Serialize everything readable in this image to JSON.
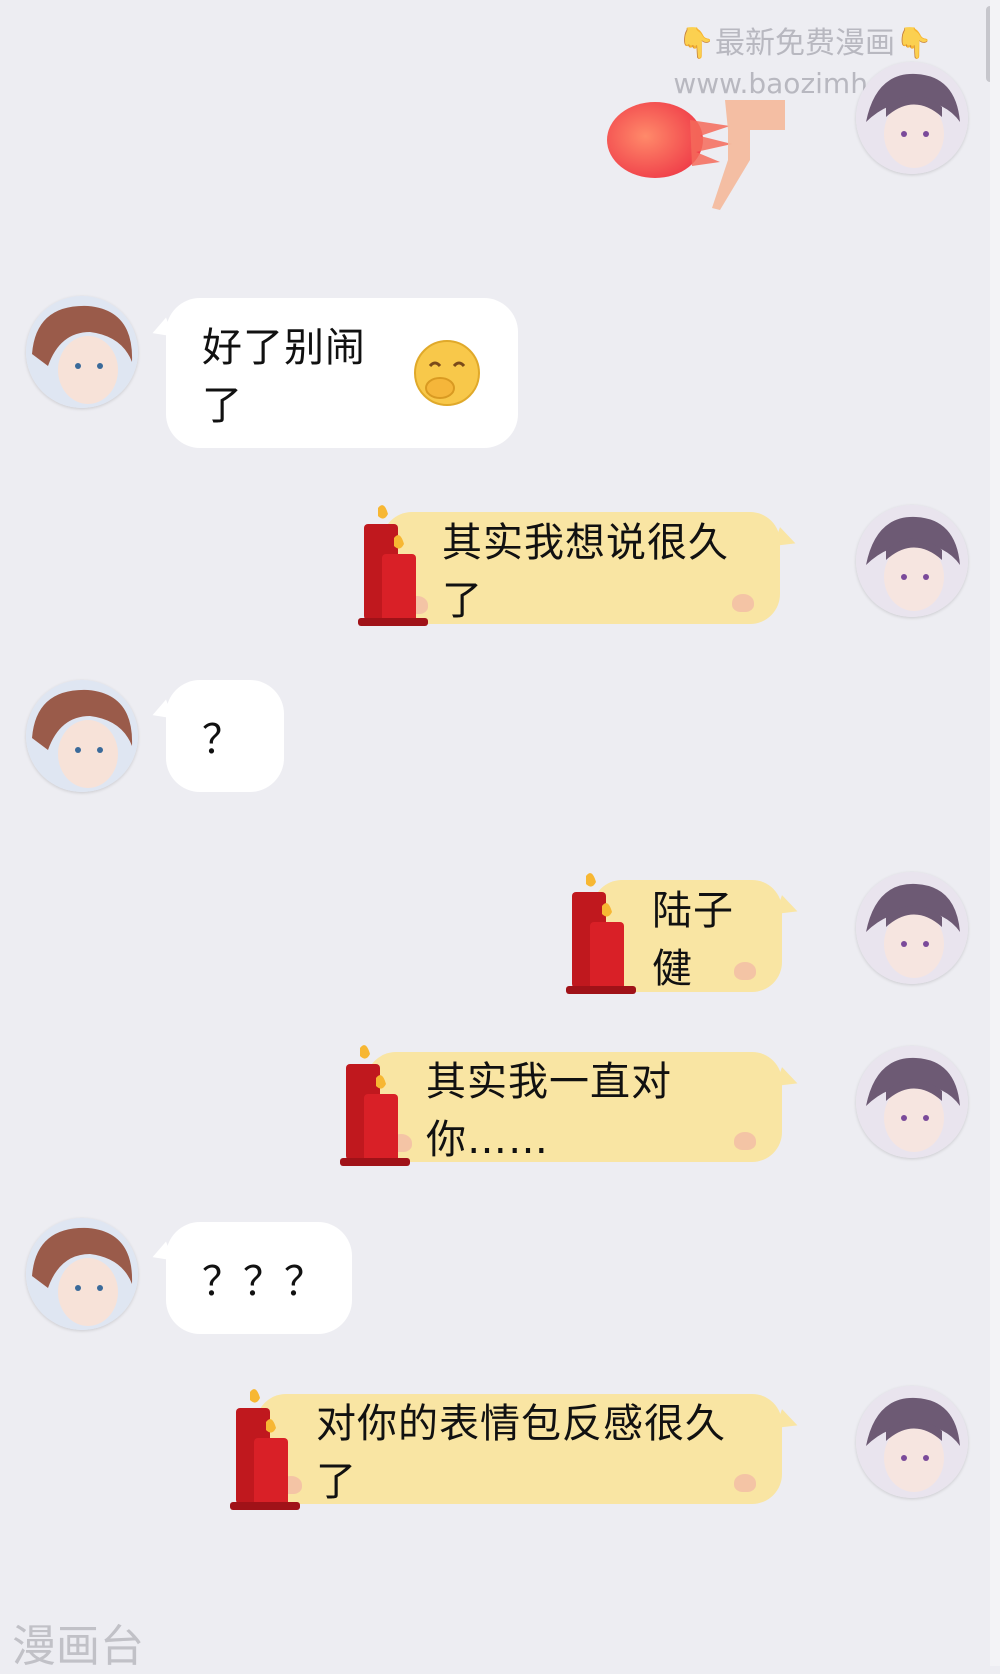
{
  "watermark": {
    "top_text": "最新免费漫画",
    "top_url": "www.baozimh.com",
    "bottom_text": "漫画台"
  },
  "messages": [
    {
      "text": "好了别闹了",
      "sender": "friend"
    },
    {
      "text": "其实我想说很久了",
      "sender": "me"
    },
    {
      "text": "？",
      "sender": "friend"
    },
    {
      "text": "陆子健",
      "sender": "me"
    },
    {
      "text": "其实我一直对你……",
      "sender": "me"
    },
    {
      "text": "？？？",
      "sender": "friend"
    },
    {
      "text": "对你的表情包反感很久了",
      "sender": "me"
    }
  ],
  "colors": {
    "background": "#ededf2",
    "friend_bubble": "#ffffff",
    "my_bubble": "#f9e5a3"
  },
  "icons": [
    "fireball-sticker",
    "shy-emoji-icon",
    "candle-icon",
    "avatar-friend",
    "avatar-me"
  ]
}
